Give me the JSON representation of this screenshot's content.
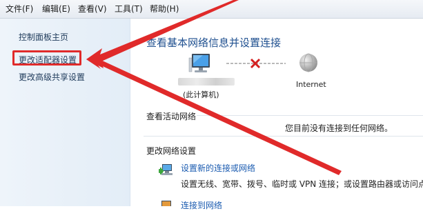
{
  "menu": {
    "file": "文件(F)",
    "edit": "编辑(E)",
    "view": "查看(V)",
    "tools": "工具(T)",
    "help": "帮助(H)"
  },
  "sidebar": {
    "items": [
      {
        "label": "控制面板主页"
      },
      {
        "label": "更改适配器设置"
      },
      {
        "label": "更改高级共享设置"
      }
    ]
  },
  "main": {
    "title": "查看基本网络信息并设置连接",
    "network_map": {
      "computer_label": "(此计算机)",
      "internet_label": "Internet"
    },
    "active_networks": {
      "heading": "查看活动网络",
      "status": "您目前没有连接到任何网络。"
    },
    "change_settings": {
      "heading": "更改网络设置",
      "tasks": [
        {
          "title": "设置新的连接或网络",
          "description": "设置无线、宽带、拨号、临时或 VPN 连接；或设置路由器或访问点。"
        },
        {
          "title": "连接到网络"
        }
      ]
    }
  },
  "annotation": {
    "color": "#e02a2a"
  }
}
